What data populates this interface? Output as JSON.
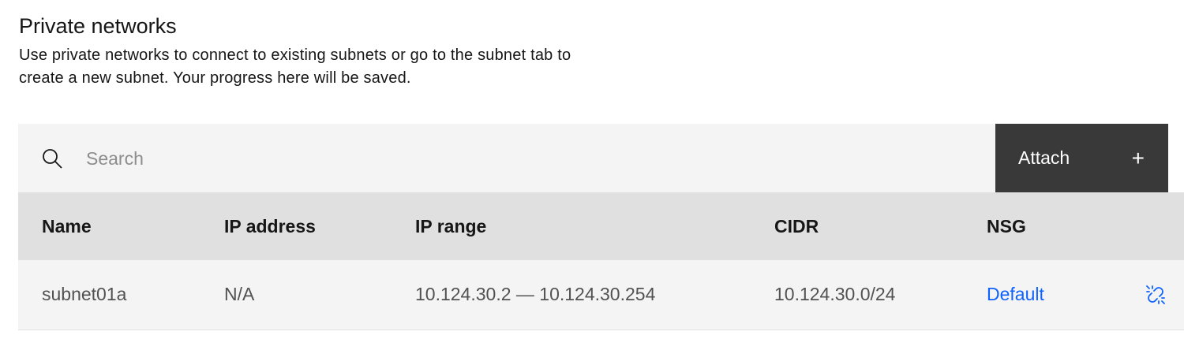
{
  "section": {
    "title": "Private networks",
    "description": "Use private networks to connect to existing subnets or go to the subnet tab to create a new subnet. Your progress here will be saved."
  },
  "toolbar": {
    "search_placeholder": "Search",
    "search_value": "",
    "search_icon": "search-icon",
    "attach_label": "Attach",
    "attach_icon": "+"
  },
  "table": {
    "columns": [
      "Name",
      "IP address",
      "IP range",
      "CIDR",
      "NSG"
    ],
    "rows": [
      {
        "name": "subnet01a",
        "ip_address": "N/A",
        "ip_range": "10.124.30.2 — 10.124.30.254",
        "cidr": "10.124.30.0/24",
        "nsg": "Default",
        "action_icon": "unlink-icon"
      }
    ]
  },
  "colors": {
    "toolbar_bg": "#f4f4f4",
    "header_bg": "#e0e0e0",
    "button_bg": "#393939",
    "link": "#0f62fe"
  }
}
